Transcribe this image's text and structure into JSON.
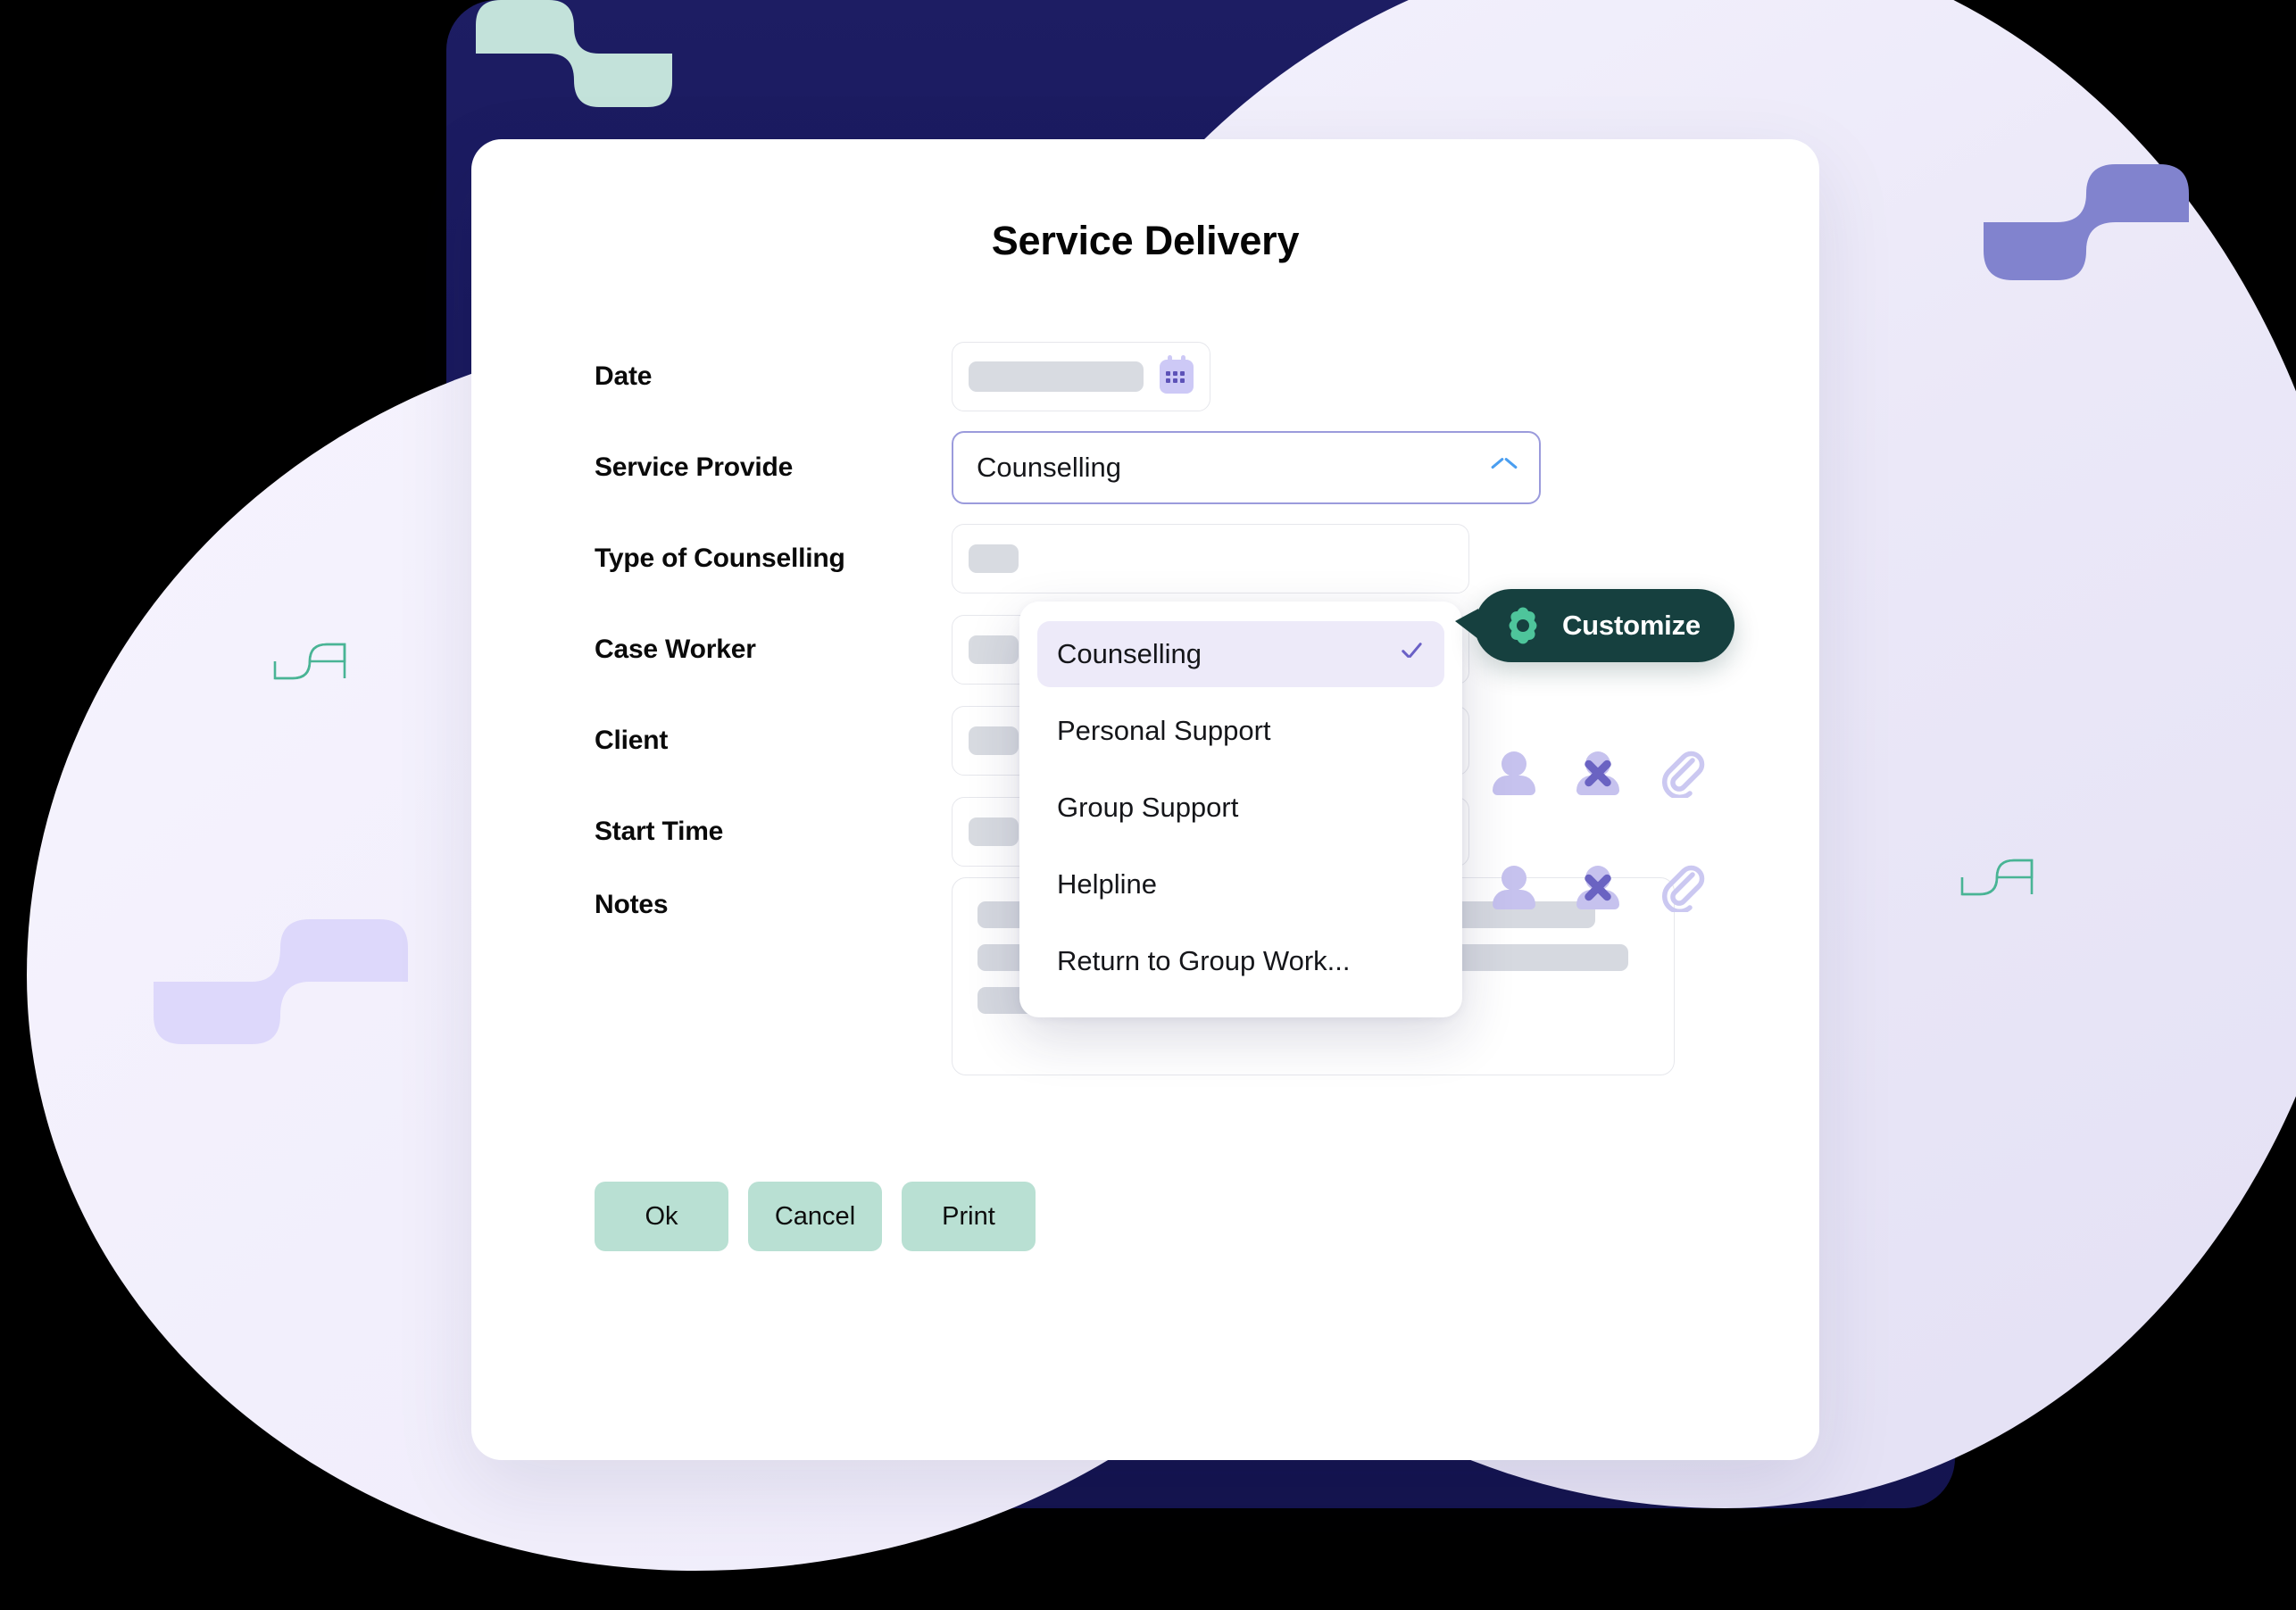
{
  "card": {
    "title": "Service Delivery"
  },
  "form": {
    "rows": [
      {
        "label": "Date",
        "control": "date"
      },
      {
        "label": "Service Provide",
        "control": "select"
      },
      {
        "label": "Type of Counselling",
        "control": "skeleton"
      },
      {
        "label": "Case Worker",
        "control": "skeleton-icons"
      },
      {
        "label": "Client",
        "control": "skeleton-icons"
      },
      {
        "label": "Start Time",
        "control": "skeleton"
      },
      {
        "label": "Notes",
        "control": "textarea"
      }
    ]
  },
  "service_provide": {
    "value": "Counselling",
    "expanded": true,
    "chevron_icon": "chevron-up-icon",
    "border_color": "#9b9bdc",
    "chevron_color": "#4a9ef0"
  },
  "dropdown": {
    "options": [
      {
        "label": "Counselling",
        "selected": true
      },
      {
        "label": "Personal Support",
        "selected": false
      },
      {
        "label": "Group Support",
        "selected": false
      },
      {
        "label": "Helpline",
        "selected": false
      },
      {
        "label": "Return to Group Work...",
        "selected": false
      }
    ],
    "selected_bg": "#edeaf9",
    "check_color": "#6a60c6"
  },
  "customize_badge": {
    "label": "Customize",
    "icon": "gear-icon",
    "bg_color": "#16403f",
    "icon_color": "#4ec59b",
    "text_color": "#ffffff"
  },
  "date_field": {
    "icon": "calendar-icon",
    "icon_bg": "#cdc9f6"
  },
  "row_icons": [
    {
      "name": "person-icon",
      "color": "#c6c2ee"
    },
    {
      "name": "person-remove-icon",
      "color": "#6a63c2"
    },
    {
      "name": "paperclip-icon",
      "color": "#cbc8f1"
    }
  ],
  "buttons": [
    {
      "label": "Ok"
    },
    {
      "label": "Cancel"
    },
    {
      "label": "Print"
    }
  ],
  "theme": {
    "button_bg": "#b9e0d3",
    "navy_backdrop": "#191a5c",
    "lavender_blob": "#efecfa",
    "mint_accent": "#c3e2da",
    "purple_accent": "#8183ce",
    "teal_mark": "#49b495"
  },
  "decor": {
    "marks": [
      {
        "name": "scurve-mint-large",
        "color": "#c3e2da"
      },
      {
        "name": "scurve-purple-large",
        "color": "#8183ce"
      },
      {
        "name": "scurve-lavender",
        "color": "#ddd8fb"
      },
      {
        "name": "scurve-teal-left",
        "color": "#49b495"
      },
      {
        "name": "scurve-teal-right",
        "color": "#49b495"
      }
    ]
  }
}
